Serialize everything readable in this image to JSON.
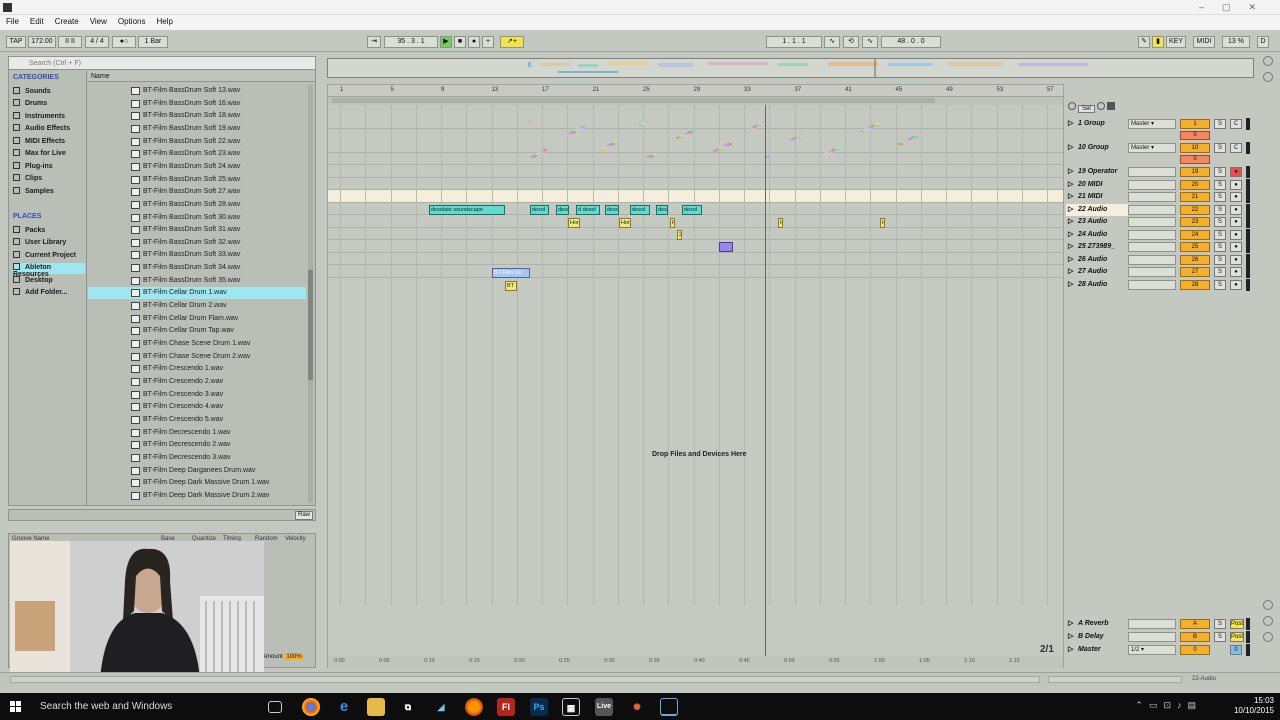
{
  "menu": [
    "File",
    "Edit",
    "Create",
    "View",
    "Options",
    "Help"
  ],
  "controls": {
    "tap": "TAP",
    "tempo": "172.00",
    "meter": "4 / 4",
    "quantize": "1 Bar",
    "position": "35 . 3 . 1",
    "loop_start": "1 . 1 . 1",
    "loop_length": "48 . 0 . 0",
    "key": "KEY",
    "midi": "MIDI",
    "cpu": "13 %",
    "d": "D"
  },
  "browser": {
    "search_placeholder": "Search (Ctrl + F)",
    "categories_title": "CATEGORIES",
    "categories": [
      "Sounds",
      "Drums",
      "Instruments",
      "Audio Effects",
      "MIDI Effects",
      "Max for Live",
      "Plug-ins",
      "Clips",
      "Samples"
    ],
    "places_title": "PLACES",
    "places": [
      "Packs",
      "User Library",
      "Current Project",
      "Ableton Resources",
      "Desktop",
      "Add Folder..."
    ],
    "name_header": "Name",
    "files": [
      "BT-Film BassDrum Soft 13.wav",
      "BT-Film BassDrum Soft 16.wav",
      "BT-Film BassDrum Soft 18.wav",
      "BT-Film BassDrum Soft 19.wav",
      "BT-Film BassDrum Soft 22.wav",
      "BT-Film BassDrum Soft 23.wav",
      "BT-Film BassDrum Soft 24.wav",
      "BT-Film BassDrum Soft 25.wav",
      "BT-Film BassDrum Soft 27.wav",
      "BT-Film BassDrum Soft 28.wav",
      "BT-Film BassDrum Soft 30.wav",
      "BT-Film BassDrum Soft 31.wav",
      "BT-Film BassDrum Soft 32.wav",
      "BT-Film BassDrum Soft 33.wav",
      "BT-Film BassDrum Soft 34.wav",
      "BT-Film BassDrum Soft 35.wav",
      "BT-Film Cellar Drum 1.wav",
      "BT-Film Cellar Drum 2.wav",
      "BT-Film Cellar Drum Flam.wav",
      "BT-Film Cellar Drum Tap.wav",
      "BT-Film Chase Scene Drum 1.wav",
      "BT-Film Chase Scene Drum 2.wav",
      "BT-Film Crescendo 1.wav",
      "BT-Film Crescendo 2.wav",
      "BT-Film Crescendo 3.wav",
      "BT-Film Crescendo 4.wav",
      "BT-Film Crescendo 5.wav",
      "BT-Film Decrescendo 1.wav",
      "BT-Film Decrescendo 2.wav",
      "BT-Film Decrescendo 3.wav",
      "BT-Film Deep Darganees Drum.wav",
      "BT-Film Deep Dark Massive Drum 1.wav",
      "BT-Film Deep Dark Massive Drum 2.wav"
    ],
    "selected_file_index": 16,
    "preview_raw": "Raw"
  },
  "groove": {
    "headers": [
      "Groove Name",
      "Base",
      "Quantize",
      "Timing",
      "Random",
      "Velocity"
    ],
    "amount_label": "Amount",
    "amount_value": "100%"
  },
  "ruler": [
    "1",
    "5",
    "9",
    "13",
    "17",
    "21",
    "25",
    "29",
    "33",
    "37",
    "41",
    "45",
    "49",
    "53",
    "57"
  ],
  "time_ticks": [
    "0:00",
    "0:05",
    "0:10",
    "0:15",
    "0:20",
    "0:25",
    "0:30",
    "0:35",
    "0:40",
    "0:45",
    "0:50",
    "0:55",
    "1:00",
    "1:05",
    "1:10",
    "1:15"
  ],
  "clips": [
    {
      "label": "desolate soundscape",
      "kind": "c"
    },
    {
      "label": "desol",
      "kind": "c"
    },
    {
      "label": "deso",
      "kind": "c"
    },
    {
      "label": "d desol",
      "kind": "c"
    },
    {
      "label": "deso",
      "kind": "c"
    },
    {
      "label": "desol",
      "kind": "c"
    },
    {
      "label": "deso",
      "kind": "c"
    },
    {
      "label": "desol",
      "kind": "c"
    },
    {
      "label": "Hor",
      "kind": "y"
    },
    {
      "label": "Hor",
      "kind": "y"
    },
    {
      "label": "H",
      "kind": "y"
    },
    {
      "label": "H",
      "kind": "y"
    },
    {
      "label": "H",
      "kind": "y"
    },
    {
      "label": "2",
      "kind": "y"
    },
    {
      "label": "",
      "kind": "p"
    },
    {
      "label": "BT-Film Ce",
      "kind": "b"
    },
    {
      "label": "BT",
      "kind": "y"
    }
  ],
  "drop_text": "Drop Files and Devices Here",
  "set_label": "Set",
  "tracks": [
    {
      "name": "1 Group",
      "io": "Master",
      "num": "1",
      "pan": "0",
      "solo": "S",
      "rec": "C",
      "group": true
    },
    {
      "name": "10 Group",
      "io": "Master",
      "num": "10",
      "pan": "0",
      "solo": "S",
      "rec": "C",
      "group": true
    },
    {
      "name": "19 Operator",
      "io": "",
      "num": "19",
      "solo": "S",
      "rec": "●"
    },
    {
      "name": "20 MIDI",
      "io": "",
      "num": "20",
      "solo": "S",
      "rec": "●"
    },
    {
      "name": "21 MIDI",
      "io": "",
      "num": "21",
      "solo": "S",
      "rec": "●"
    },
    {
      "name": "22 Audio",
      "io": "",
      "num": "22",
      "solo": "S",
      "rec": "●",
      "highlight": true
    },
    {
      "name": "23 Audio",
      "io": "",
      "num": "23",
      "solo": "S",
      "rec": "●"
    },
    {
      "name": "24 Audio",
      "io": "",
      "num": "24",
      "solo": "S",
      "rec": "●"
    },
    {
      "name": "25 273989_",
      "io": "",
      "num": "25",
      "solo": "S",
      "rec": "●"
    },
    {
      "name": "26 Audio",
      "io": "",
      "num": "26",
      "solo": "S",
      "rec": "●"
    },
    {
      "name": "27 Audio",
      "io": "",
      "num": "27",
      "solo": "S",
      "rec": "●"
    },
    {
      "name": "28 Audio",
      "io": "",
      "num": "28",
      "solo": "S",
      "rec": "●"
    }
  ],
  "returns": [
    {
      "name": "A Reverb",
      "num": "A",
      "solo": "S",
      "post": "Post"
    },
    {
      "name": "B Delay",
      "num": "B",
      "solo": "S",
      "post": "Post"
    },
    {
      "name": "Master",
      "io": "1/2",
      "num": "0",
      "pan": "0"
    }
  ],
  "page_indicator": "2/1",
  "status_track": "22-Audio",
  "taskbar": {
    "search": "Search the web and Windows",
    "time": "15:03",
    "date": "10/10/2015"
  }
}
